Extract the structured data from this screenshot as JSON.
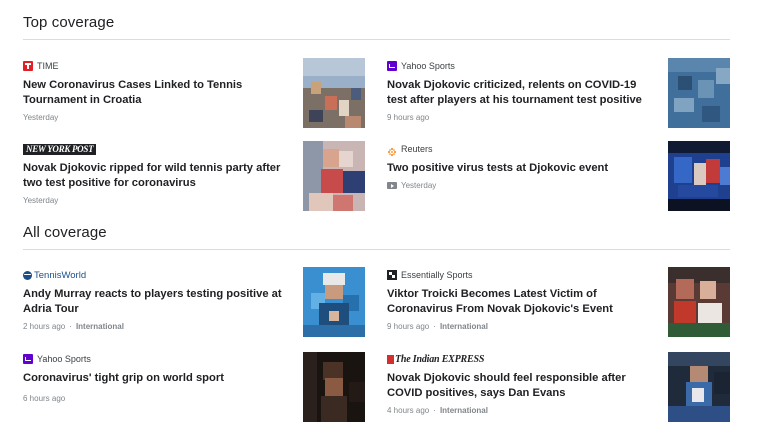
{
  "top_coverage": {
    "title": "Top coverage",
    "articles": [
      {
        "source": "TIME",
        "headline": "New Coronavirus Cases Linked to Tennis Tournament in Croatia",
        "time": "Yesterday"
      },
      {
        "source": "Yahoo Sports",
        "headline": "Novak Djokovic criticized, relents on COVID-19 test after players at his tournament test positive",
        "time": "9 hours ago"
      },
      {
        "source": "NEW YORK POST",
        "headline": "Novak Djokovic ripped for wild tennis party after two test positive for coronavirus",
        "time": "Yesterday"
      },
      {
        "source": "Reuters",
        "headline": "Two positive virus tests at Djokovic event",
        "time": "Yesterday"
      }
    ]
  },
  "all_coverage": {
    "title": "All coverage",
    "articles": [
      {
        "source": "TennisWorld",
        "headline": "Andy Murray reacts to players testing positive at Adria Tour",
        "time": "2 hours ago",
        "region": "International"
      },
      {
        "source": "Essentially Sports",
        "headline": "Viktor Troicki Becomes Latest Victim of Coronavirus From Novak Djokovic's Event",
        "time": "9 hours ago",
        "region": "International"
      },
      {
        "source": "Yahoo Sports",
        "headline": "Coronavirus' tight grip on world sport",
        "time": "6 hours ago"
      },
      {
        "source": "The Indian EXPRESS",
        "headline": "Novak Djokovic should feel responsible after COVID positives, says Dan Evans",
        "time": "4 hours ago",
        "region": "International"
      }
    ]
  },
  "separator": "·",
  "colors": {
    "time_red": "#e31e24",
    "yahoo_purple": "#6001d2",
    "reuters_orange": "#ff8000",
    "meta_gray": "#80868b",
    "divider": "#dadce0"
  }
}
